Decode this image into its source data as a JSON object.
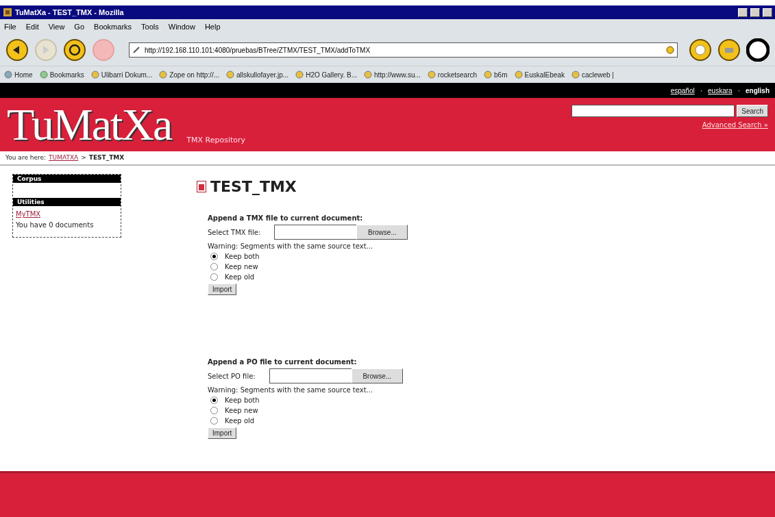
{
  "window": {
    "title": "TuMatXa - TEST_TMX - Mozilla"
  },
  "menu": [
    "File",
    "Edit",
    "View",
    "Go",
    "Bookmarks",
    "Tools",
    "Window",
    "Help"
  ],
  "address": {
    "value": "http://192.168.110.101:4080/pruebas/BTree/ZTMX/TEST_TMX/addToTMX"
  },
  "bookmarks": [
    {
      "label": "Home",
      "kind": "home"
    },
    {
      "label": "Bookmarks",
      "kind": "folder"
    },
    {
      "label": "Ulibarri Dokum...",
      "kind": "link"
    },
    {
      "label": "Zope on http://...",
      "kind": "link"
    },
    {
      "label": "allskullofayer.jp...",
      "kind": "link"
    },
    {
      "label": "H2O Gallery. B...",
      "kind": "link"
    },
    {
      "label": "http://www.su...",
      "kind": "link"
    },
    {
      "label": "rocketsearch",
      "kind": "link"
    },
    {
      "label": "b6m",
      "kind": "link"
    },
    {
      "label": "EuskalEbeak",
      "kind": "link"
    },
    {
      "label": "cacleweb |",
      "kind": "link"
    }
  ],
  "language_separators": [
    "·",
    "·"
  ],
  "languages": [
    {
      "label": "español",
      "selected": false
    },
    {
      "label": "euskara",
      "selected": false
    },
    {
      "label": "english",
      "selected": true
    }
  ],
  "site": {
    "logo": "TuMatXa",
    "tagline": "TMX Repository",
    "search_button": "Search",
    "advanced_search": "Advanced Search »"
  },
  "breadcrumb": {
    "prefix": "You are here:",
    "link": "TUMATXA",
    "separator": ">",
    "current": "TEST_TMX"
  },
  "sidebar": {
    "portlets": [
      {
        "title": "Corpus"
      },
      {
        "title": "Utilities",
        "items": [
          {
            "text": "MyTMX",
            "kind": "link"
          },
          {
            "text": "You have 0 documents",
            "kind": "text"
          }
        ]
      }
    ]
  },
  "page_title": "TEST_TMX",
  "forms": [
    {
      "title": "Append a TMX file to current document:",
      "label": "Select TMX file:",
      "browse": "Browse...",
      "warning": "Warning: Segments with the same source text...",
      "options": [
        {
          "label": "Keep both",
          "selected": true
        },
        {
          "label": "Keep new",
          "selected": false
        },
        {
          "label": "Keep old",
          "selected": false
        }
      ],
      "submit": "Import"
    },
    {
      "title": "Append a PO file to current document:",
      "label": "Select PO file:",
      "browse": "Browse...",
      "warning": "Warning: Segments with the same source text...",
      "options": [
        {
          "label": "Keep both",
          "selected": true
        },
        {
          "label": "Keep new",
          "selected": false
        },
        {
          "label": "Keep old",
          "selected": false
        }
      ],
      "submit": "Import"
    }
  ]
}
